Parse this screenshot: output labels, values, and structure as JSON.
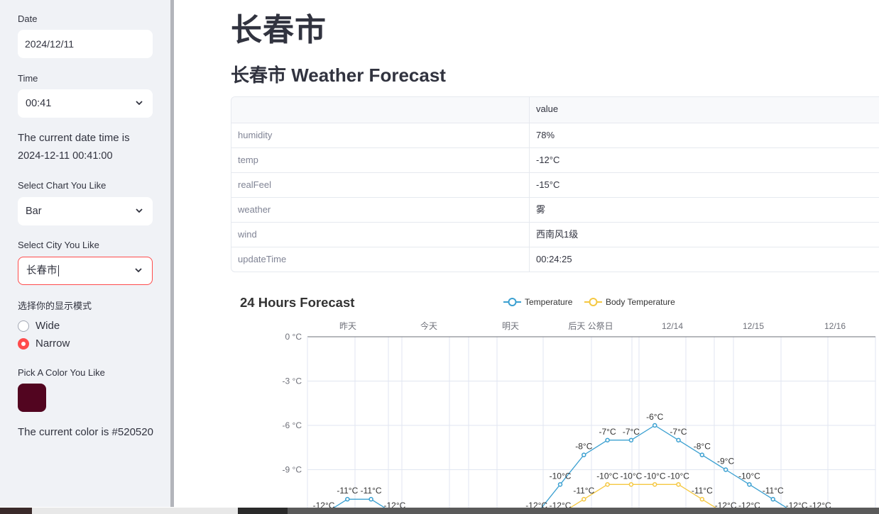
{
  "sidebar": {
    "date_label": "Date",
    "date_value": "2024/12/11",
    "time_label": "Time",
    "time_value": "00:41",
    "datetime_text_line1": "The current date time is",
    "datetime_text_line2": "2024-12-11 00:41:00",
    "chart_label": "Select Chart You Like",
    "chart_value": "Bar",
    "city_label": "Select City You Like",
    "city_value": "长春市",
    "mode_label": "选择你的显示模式",
    "mode_options": [
      "Wide",
      "Narrow"
    ],
    "mode_selected": "Narrow",
    "color_label": "Pick A Color You Like",
    "color_value": "#520520",
    "color_text": "The current color is #520520"
  },
  "main": {
    "title": "长春市",
    "subtitle": "长春市 Weather Forecast",
    "table": {
      "header": [
        "",
        "value"
      ],
      "rows": [
        {
          "key": "humidity",
          "value": "78%"
        },
        {
          "key": "temp",
          "value": "-12°C"
        },
        {
          "key": "realFeel",
          "value": "-15°C"
        },
        {
          "key": "weather",
          "value": "雾"
        },
        {
          "key": "wind",
          "value": "西南风1级"
        },
        {
          "key": "updateTime",
          "value": "00:24:25"
        }
      ]
    }
  },
  "colors": {
    "accent": "#ff4b4b",
    "temperature": "#3ba0d1",
    "body_temperature": "#f5c842"
  },
  "chart_data": {
    "type": "line",
    "title": "24 Hours Forecast",
    "legend": [
      "Temperature",
      "Body Temperature"
    ],
    "legend_position": "top-center",
    "top_axis_labels": [
      "昨天",
      "今天",
      "明天",
      "后天 公祭日",
      "12/14",
      "12/15",
      "12/16"
    ],
    "y_ticks": [
      "0 °C",
      "-3 °C",
      "-6 °C",
      "-9 °C"
    ],
    "ylim": [
      -12,
      0
    ],
    "series": [
      {
        "name": "Temperature",
        "points": [
          {
            "x": 0,
            "y": -12,
            "label": "-12°C"
          },
          {
            "x": 1,
            "y": -11,
            "label": "-11°C"
          },
          {
            "x": 2,
            "y": -11,
            "label": "-11°C"
          },
          {
            "x": 3,
            "y": -12,
            "label": "-12°C"
          },
          {
            "x": 9,
            "y": -12,
            "label": "-12°C"
          },
          {
            "x": 10,
            "y": -10,
            "label": "-10°C"
          },
          {
            "x": 11,
            "y": -8,
            "label": "-8°C"
          },
          {
            "x": 12,
            "y": -7,
            "label": "-7°C"
          },
          {
            "x": 13,
            "y": -7,
            "label": "-7°C"
          },
          {
            "x": 14,
            "y": -6,
            "label": "-6°C"
          },
          {
            "x": 15,
            "y": -7,
            "label": "-7°C"
          },
          {
            "x": 16,
            "y": -8,
            "label": "-8°C"
          },
          {
            "x": 17,
            "y": -9,
            "label": "-9°C"
          },
          {
            "x": 18,
            "y": -10,
            "label": "-10°C"
          },
          {
            "x": 19,
            "y": -11,
            "label": "-11°C"
          },
          {
            "x": 20,
            "y": -12,
            "label": "-12°C"
          },
          {
            "x": 21,
            "y": -12,
            "label": "-12°C"
          }
        ]
      },
      {
        "name": "Body Temperature",
        "points": [
          {
            "x": 10,
            "y": -12,
            "label": "-12°C"
          },
          {
            "x": 11,
            "y": -11,
            "label": "-11°C"
          },
          {
            "x": 12,
            "y": -10,
            "label": "-10°C"
          },
          {
            "x": 13,
            "y": -10,
            "label": "-10°C"
          },
          {
            "x": 14,
            "y": -10,
            "label": "-10°C"
          },
          {
            "x": 15,
            "y": -10,
            "label": "-10°C"
          },
          {
            "x": 16,
            "y": -11,
            "label": "-11°C"
          },
          {
            "x": 17,
            "y": -12,
            "label": "-12°C"
          },
          {
            "x": 18,
            "y": -12,
            "label": "-12°C"
          }
        ]
      }
    ]
  }
}
